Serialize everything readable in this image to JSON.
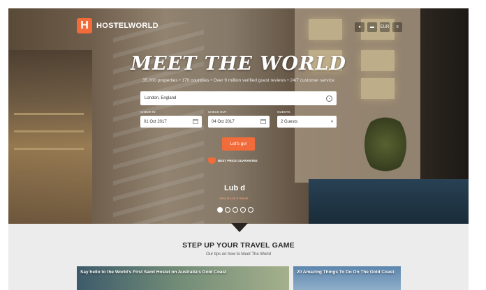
{
  "brand": {
    "logo_letter": "H",
    "name": "HOSTELWORLD",
    "accent": "#f26b3a"
  },
  "header": {
    "icons": [
      {
        "name": "account-icon",
        "glyph": "●"
      },
      {
        "name": "flag-icon",
        "glyph": "▬"
      },
      {
        "name": "currency-icon",
        "glyph": "EUR"
      },
      {
        "name": "menu-icon",
        "glyph": "≡"
      }
    ]
  },
  "hero": {
    "headline": "MEET THE WORLD",
    "tagline": "35,000 properties • 170 countries • Over 9 million verified guest reviews • 24/7 customer service"
  },
  "search": {
    "destination_value": "London, England",
    "check_in": {
      "label": "CHECK IN",
      "value": "01 Oct 2017"
    },
    "check_out": {
      "label": "CHECK OUT",
      "value": "04 Oct 2017"
    },
    "guests": {
      "label": "GUESTS",
      "value": "2 Guests"
    },
    "submit_label": "Let's go!"
  },
  "guarantee": {
    "label": "BEST PRICE GUARANTEE"
  },
  "featured_property": {
    "name": "Lub d",
    "link": "View at Lub d Samet"
  },
  "carousel": {
    "count": 5,
    "active_index": 0
  },
  "tips": {
    "title": "STEP UP YOUR TRAVEL GAME",
    "subtitle": "Our tips on how to Meet The World",
    "cards": [
      {
        "title": "Say hello to the World's First Sand Hostel on Australia's Gold Coast"
      },
      {
        "title": "20 Amazing Things To Do On The Gold Coast"
      }
    ]
  }
}
